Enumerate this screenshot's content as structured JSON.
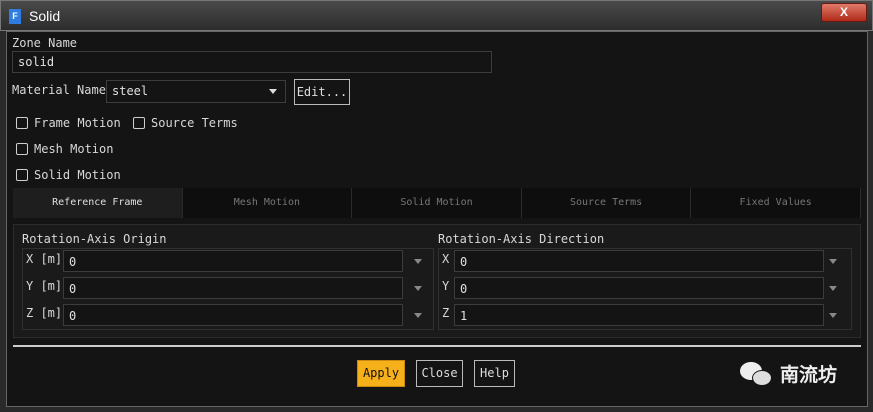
{
  "window": {
    "title": "Solid",
    "app_icon": "F",
    "close_label": "X"
  },
  "zone": {
    "label": "Zone Name",
    "value": "solid"
  },
  "material": {
    "label": "Material Name",
    "value": "steel",
    "edit_label": "Edit..."
  },
  "checkboxes": {
    "frame_motion": "Frame Motion",
    "source_terms": "Source Terms",
    "mesh_motion": "Mesh Motion",
    "solid_motion": "Solid Motion"
  },
  "tabs": [
    "Reference Frame",
    "Mesh Motion",
    "Solid Motion",
    "Source Terms",
    "Fixed Values"
  ],
  "origin": {
    "title": "Rotation-Axis Origin",
    "rows": [
      {
        "label": "X [m]",
        "value": "0"
      },
      {
        "label": "Y [m]",
        "value": "0"
      },
      {
        "label": "Z [m]",
        "value": "0"
      }
    ]
  },
  "direction": {
    "title": "Rotation-Axis Direction",
    "rows": [
      {
        "label": "X",
        "value": "0"
      },
      {
        "label": "Y",
        "value": "0"
      },
      {
        "label": "Z",
        "value": "1"
      }
    ]
  },
  "buttons": {
    "apply": "Apply",
    "close": "Close",
    "help": "Help"
  },
  "watermark": {
    "text": "南流坊"
  },
  "colors": {
    "accent": "#f5b01a"
  }
}
